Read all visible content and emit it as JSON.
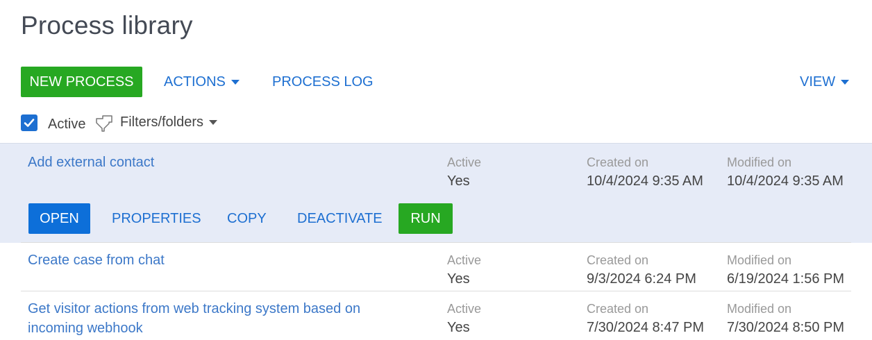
{
  "page": {
    "title": "Process library"
  },
  "toolbar": {
    "new_process": "NEW PROCESS",
    "actions": "ACTIONS",
    "process_log": "PROCESS LOG",
    "view": "VIEW"
  },
  "filters": {
    "active_checked": true,
    "active_label": "Active",
    "filters_folders": "Filters/folders"
  },
  "columns": {
    "active": "Active",
    "created_on": "Created on",
    "modified_on": "Modified on"
  },
  "rows": [
    {
      "name": "Add external contact",
      "active": "Yes",
      "created": "10/4/2024 9:35 AM",
      "modified": "10/4/2024 9:35 AM",
      "selected": true
    },
    {
      "name": "Create case from chat",
      "active": "Yes",
      "created": "9/3/2024 6:24 PM",
      "modified": "6/19/2024 1:56 PM",
      "selected": false
    },
    {
      "name": "Get visitor actions from web tracking system based on incoming webhook",
      "active": "Yes",
      "created": "7/30/2024 8:47 PM",
      "modified": "7/30/2024 8:50 PM",
      "selected": false
    }
  ],
  "row_actions": {
    "open": "OPEN",
    "properties": "PROPERTIES",
    "copy": "COPY",
    "deactivate": "DEACTIVATE",
    "run": "RUN"
  },
  "colors": {
    "green": "#27a822",
    "blue_link": "#1d6fd1",
    "selected_row": "#e6ebf7"
  }
}
